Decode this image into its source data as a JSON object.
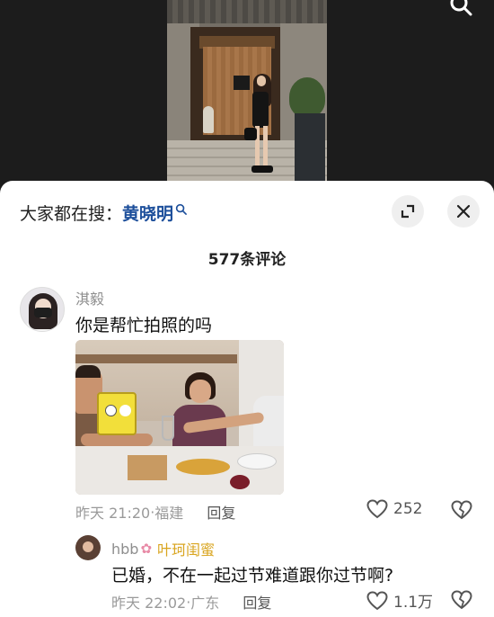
{
  "hot_search": {
    "prefix": "大家都在搜：",
    "keyword": "黄晓明"
  },
  "comments_header": {
    "count_label": "577条评论"
  },
  "comment": {
    "username": "淇毅",
    "text": "你是帮忙拍照的吗",
    "time": "昨天 21:20",
    "location": "福建",
    "reply_label": "回复",
    "likes": "252"
  },
  "reply_comment": {
    "username": "hbb",
    "tag": "叶珂闺蜜",
    "text": "已婚，不在一起过节难道跟你过节啊?",
    "time": "昨天 22:02",
    "location": "广东",
    "reply_label": "回复",
    "likes": "1.1万"
  },
  "colors": {
    "keyword": "#1d4f9b",
    "tag": "#d9a520",
    "sheet_bg": "#ffffff",
    "video_bg": "#1c1c1c"
  }
}
